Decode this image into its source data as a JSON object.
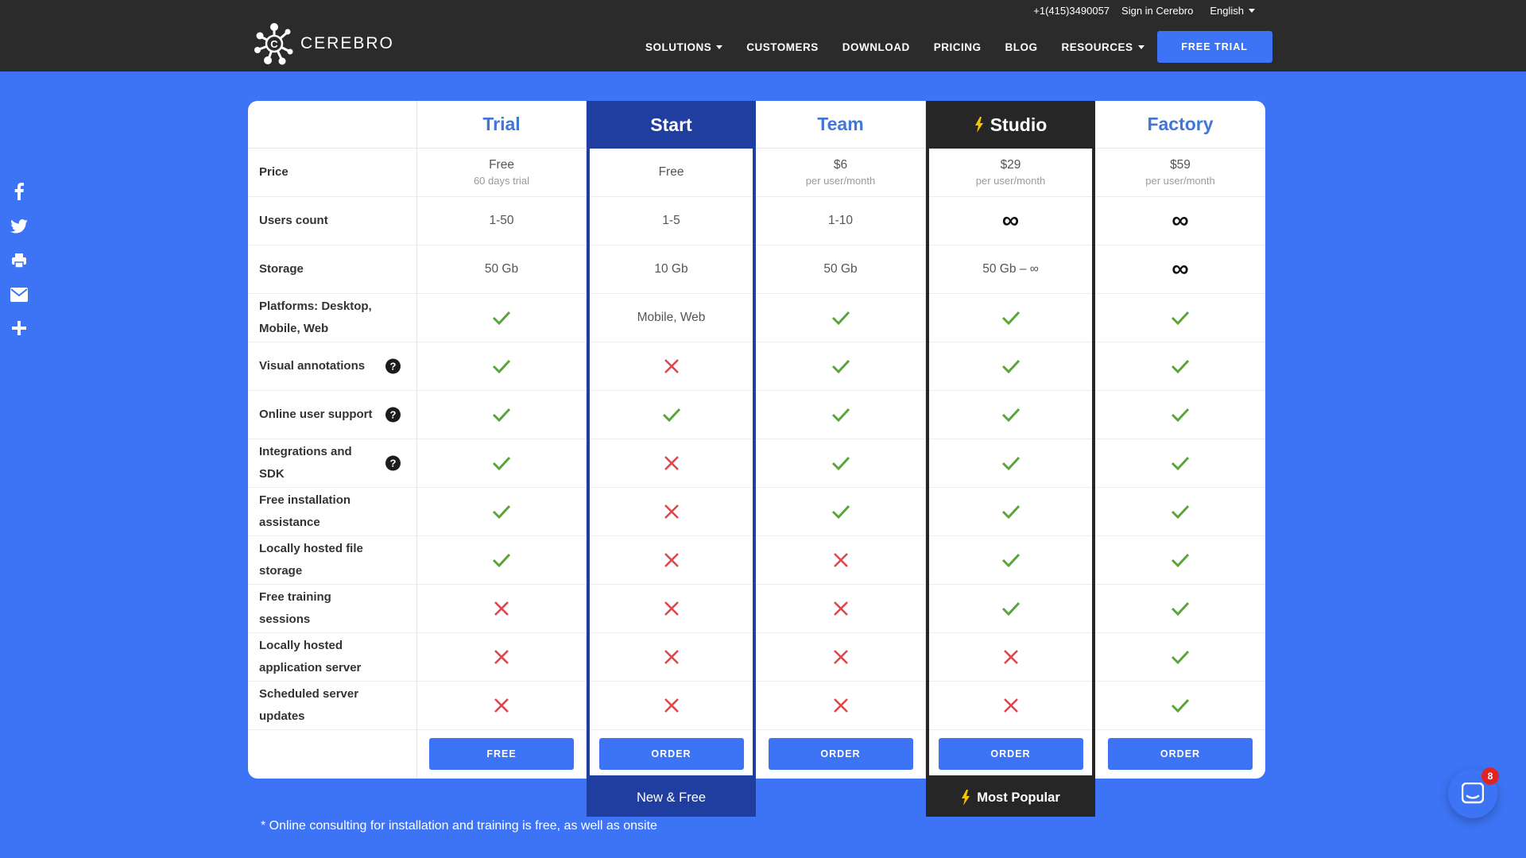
{
  "header": {
    "phone": "+1(415)3490057",
    "sign_in": "Sign in Cerebro",
    "language": "English",
    "logo_text": "CEREBRO",
    "nav": [
      "SOLUTIONS",
      "CUSTOMERS",
      "DOWNLOAD",
      "PRICING",
      "BLOG",
      "RESOURCES"
    ],
    "free_trial": "FREE TRIAL"
  },
  "social": [
    "facebook-icon",
    "twitter-icon",
    "print-icon",
    "email-icon",
    "plus-icon"
  ],
  "plans": [
    "Trial",
    "Start",
    "Team",
    "Studio",
    "Factory"
  ],
  "features": [
    "Price",
    "Users count",
    "Storage",
    "Platforms: Desktop, Mobile, Web",
    "Visual annotations",
    "Online user support",
    "Integrations and SDK",
    "Free installation assistance",
    "Locally hosted file storage",
    "Free training sessions",
    "Locally hosted application server",
    "Scheduled server updates"
  ],
  "help_icons": [
    false,
    false,
    false,
    false,
    true,
    true,
    true,
    false,
    false,
    false,
    false,
    false
  ],
  "prices": [
    {
      "main": "Free",
      "sub": "60 days trial"
    },
    {
      "main": "Free",
      "sub": ""
    },
    {
      "main": "$6",
      "sub": "per user/month"
    },
    {
      "main": "$29",
      "sub": "per user/month"
    },
    {
      "main": "$59",
      "sub": "per user/month"
    }
  ],
  "users_count": [
    "1-50",
    "1-5",
    "1-10",
    "∞",
    "∞"
  ],
  "storage": [
    "50 Gb",
    "10 Gb",
    "50 Gb",
    "50 Gb – ∞",
    "∞"
  ],
  "matrix": [
    [
      "check",
      "Mobile, Web",
      "check",
      "check",
      "check"
    ],
    [
      "check",
      "cross",
      "check",
      "check",
      "check"
    ],
    [
      "check",
      "check",
      "check",
      "check",
      "check"
    ],
    [
      "check",
      "cross",
      "check",
      "check",
      "check"
    ],
    [
      "check",
      "cross",
      "check",
      "check",
      "check"
    ],
    [
      "check",
      "cross",
      "cross",
      "check",
      "check"
    ],
    [
      "cross",
      "cross",
      "cross",
      "check",
      "check"
    ],
    [
      "cross",
      "cross",
      "cross",
      "cross",
      "check"
    ],
    [
      "cross",
      "cross",
      "cross",
      "cross",
      "check"
    ]
  ],
  "buttons": [
    "FREE",
    "ORDER",
    "ORDER",
    "ORDER",
    "ORDER"
  ],
  "ribbons": {
    "start": "New & Free",
    "studio": "Most Popular"
  },
  "footnote": "* Online consulting for installation and training is free, as well as onsite",
  "chat_badge": "8",
  "colors": {
    "background": "#3d74f5",
    "header": "#2b2b2b",
    "start": "#1f3e9f",
    "studio": "#262626",
    "check": "#5aa53b",
    "cross": "#e0464b",
    "accent": "#f5c400"
  }
}
